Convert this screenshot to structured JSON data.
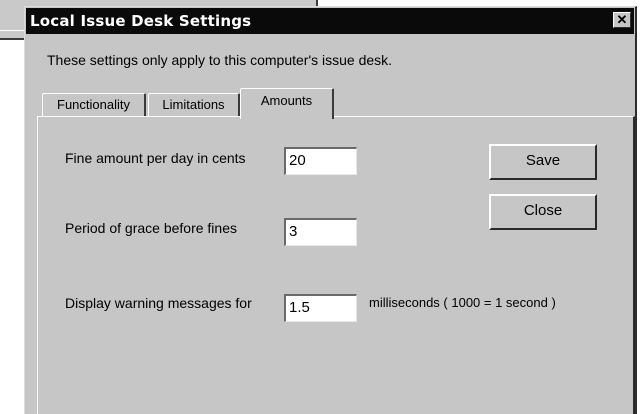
{
  "dialog": {
    "title": "Local Issue Desk Settings",
    "close_glyph": "✕",
    "info_text": "These settings only apply to this computer's issue desk."
  },
  "tabs": [
    {
      "label": "Functionality",
      "selected": false
    },
    {
      "label": "Limitations",
      "selected": false
    },
    {
      "label": "Amounts",
      "selected": true
    }
  ],
  "fields": {
    "fine_amount": {
      "label": "Fine amount per day in cents",
      "value": "20"
    },
    "grace_period": {
      "label": "Period of grace before fines",
      "value": "3"
    },
    "warning_duration": {
      "label": "Display warning messages for",
      "value": "1.5",
      "suffix": "milliseconds ( 1000 = 1 second )"
    }
  },
  "buttons": {
    "save": "Save",
    "close": "Close"
  },
  "colors": {
    "dialog_face": "#c6c6c6",
    "titlebar": "#0a0a0a",
    "titlebar_text": "#ffffff"
  },
  "icons": {
    "close": "close-icon"
  }
}
